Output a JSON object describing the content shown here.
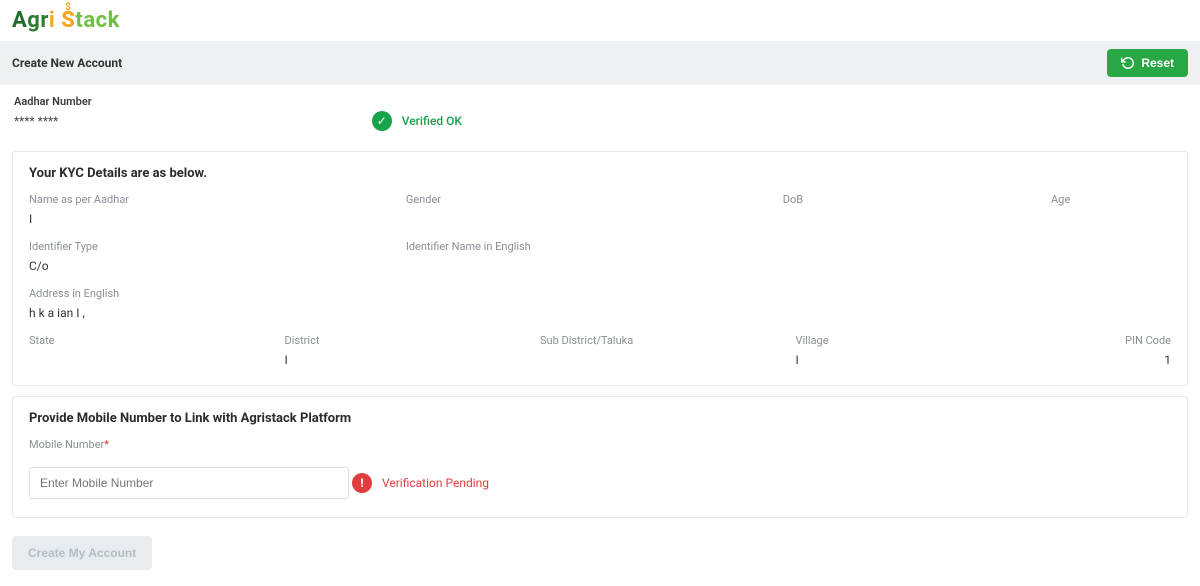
{
  "logo": {
    "text_parts": [
      "A",
      "g",
      "r",
      "i",
      " ",
      "S",
      "tack"
    ],
    "alt": "AgriStack"
  },
  "header": {
    "title": "Create New Account",
    "reset_label": "Reset"
  },
  "aadhar": {
    "label": "Aadhar Number",
    "masked": "**** ****",
    "verified_label": "Verified OK"
  },
  "kyc": {
    "title": "Your KYC Details are as below.",
    "name_label": "Name as per Aadhar",
    "name_value": "I",
    "gender_label": "Gender",
    "gender_value": "",
    "dob_label": "DoB",
    "dob_value": "",
    "age_label": "Age",
    "age_value": "",
    "id_type_label": "Identifier Type",
    "id_type_value": "C/o",
    "id_name_label": "Identifier Name in English",
    "id_name_value": "",
    "address_label": "Address in English",
    "address_value": "h                 k          a              ian         I ,",
    "state_label": "State",
    "state_value": "",
    "district_label": "District",
    "district_value": "I",
    "subdistrict_label": "Sub District/Taluka",
    "subdistrict_value": "",
    "village_label": "Village",
    "village_value": "I",
    "pincode_label": "PIN Code",
    "pincode_value": "1"
  },
  "mobile": {
    "title": "Provide Mobile Number to Link with Agristack Platform",
    "label": "Mobile Number",
    "required": "*",
    "placeholder": "Enter Mobile Number",
    "verification_pending": "Verification Pending"
  },
  "create_button_label": "Create My Account"
}
